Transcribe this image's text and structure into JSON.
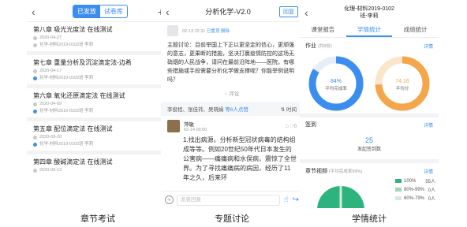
{
  "phone1": {
    "tab_active": "已发放",
    "tab_inactive": "试卷库",
    "items": [
      {
        "title": "第八章 吸光光度法 在线测试",
        "date": "2020-04-27",
        "info": "化学-材料2019-0102班 李莉",
        "status_blue": false
      },
      {
        "title": "第七章 重量分析及沉淀滴定法-边希",
        "date": "2020-04-17",
        "info": "化学-材料2019-0102班 李莉",
        "status_blue": true
      },
      {
        "title": "第六章 氧化还原滴定法 在线测试",
        "date": "2020-04-09",
        "info": "化学-材料2019-0102班 李莉",
        "status_blue": true
      },
      {
        "title": "第五章 配位滴定法 在线测试",
        "date": "2020-03-20",
        "info": "化学-材料2019-0102班 李莉",
        "status_blue": true
      },
      {
        "title": "第四章 酸碱滴定法 在线测试",
        "date": "2020-03-13",
        "info": "",
        "status_blue": false
      }
    ],
    "caption": "章节考试"
  },
  "phone2": {
    "title": "分析化学-V2.0",
    "reply_label": "回复",
    "author_time": "02-13 22:31",
    "author_tag": "已置顶",
    "author_extra": "删除",
    "topic": "主题讨论：目前举国上下正以更坚定的信心，更顽强的意志，更果断的措施，坚决打赢疫情防控的这场无硝烟的人民战争，请问在最前沿阵地——医院，有哪些措施或手段需要分析化学做支撑呢？你能举例说明吗？",
    "comment_label": "评论",
    "likes_text": "李俊程、张佳祎、吴晓娟",
    "likes_more": "等6人点赞",
    "time_label": "时间",
    "reply_name": "萍敏",
    "reply_time": "02-14 00:00",
    "reply_like_count": "0",
    "reply_text": "1.找出病源。分析新型冠状病毒的结构组成等等。例如20世纪50年代日本发生的公害病——痛痛病和水俣病，震惊了全世界。为了寻找痛痛病的病因，经历了11年之久，后来环",
    "input_placeholder": "发表回复",
    "caption": "专题讨论"
  },
  "phone3": {
    "title_line1": "化理-材料2019-0102",
    "title_line2": "班-李莉",
    "tabs": [
      "课堂报告",
      "学情统计",
      "成绩统计"
    ],
    "active_tab": 1,
    "homework_label": "作业",
    "homework_sub": "(共8份)",
    "detail_label": "详情",
    "donut1_value": "84%",
    "donut1_label": "平均完成率",
    "donut2_value": "74.16",
    "donut2_label": "平均分",
    "checkin_label": "签到",
    "checkin_count": "25",
    "checkin_text": "发起签到数",
    "chapter_label": "章节视频",
    "chapter_sub": "(平均完成率99%)",
    "legend": [
      {
        "label": "100%",
        "count": "55人",
        "color": "#2db37e"
      },
      {
        "label": "80%-99%",
        "count": "0人",
        "color": "#9fd6b3"
      },
      {
        "label": "60%-79%",
        "count": "0人",
        "color": "#d3ecd9"
      }
    ],
    "colors": {
      "blue": "#3b8ef0",
      "orange": "#f5a54a",
      "green": "#2db37e"
    },
    "caption": "学情统计"
  }
}
